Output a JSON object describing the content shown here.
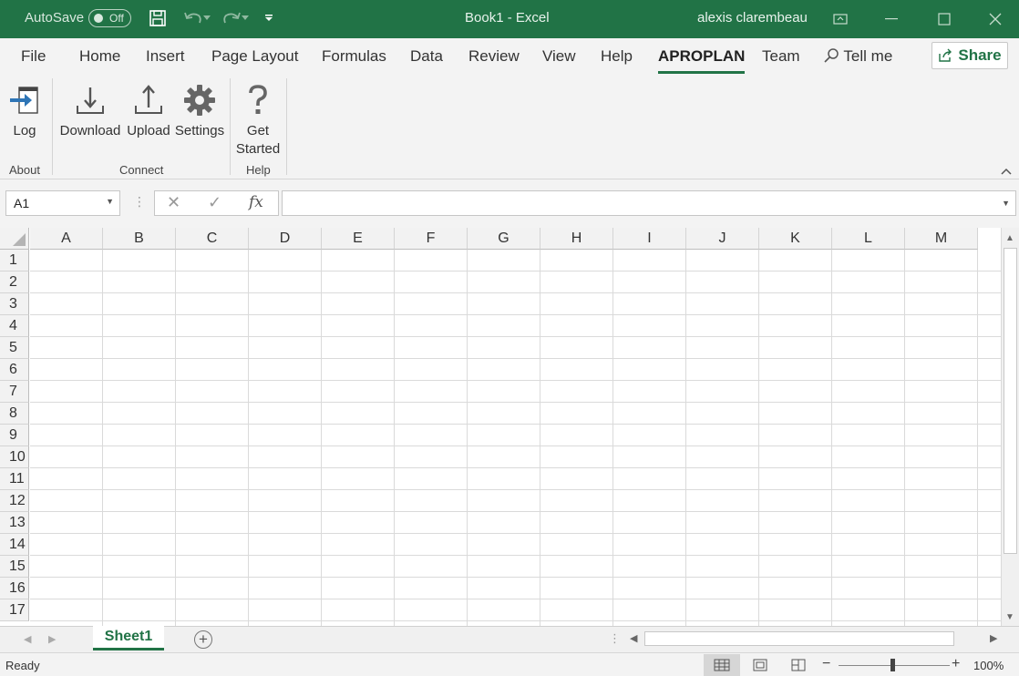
{
  "titlebar": {
    "autosave_label": "AutoSave",
    "autosave_state": "Off",
    "title": "Book1  -  Excel",
    "user": "alexis clarembeau"
  },
  "tabs": [
    {
      "label": "File"
    },
    {
      "label": "Home"
    },
    {
      "label": "Insert"
    },
    {
      "label": "Page Layout"
    },
    {
      "label": "Formulas"
    },
    {
      "label": "Data"
    },
    {
      "label": "Review"
    },
    {
      "label": "View"
    },
    {
      "label": "Help"
    },
    {
      "label": "APROPLAN",
      "active": true
    },
    {
      "label": "Team"
    }
  ],
  "tell_me": "Tell me",
  "share_label": "Share",
  "ribbon": {
    "buttons": [
      {
        "label": "Log",
        "icon": "log-icon"
      },
      {
        "label": "Download",
        "icon": "download-icon"
      },
      {
        "label": "Upload",
        "icon": "upload-icon"
      },
      {
        "label": "Settings",
        "icon": "gear-icon"
      },
      {
        "label": "Get Started",
        "icon": "question-icon"
      }
    ],
    "groups": [
      "About",
      "Connect",
      "Help"
    ]
  },
  "formula_bar": {
    "name_box": "A1",
    "formula": ""
  },
  "grid": {
    "columns": [
      "A",
      "B",
      "C",
      "D",
      "E",
      "F",
      "G",
      "H",
      "I",
      "J",
      "K",
      "L",
      "M"
    ],
    "rows": [
      "1",
      "2",
      "3",
      "4",
      "5",
      "6",
      "7",
      "8",
      "9",
      "10",
      "11",
      "12",
      "13",
      "14",
      "15",
      "16",
      "17"
    ]
  },
  "sheets": [
    {
      "name": "Sheet1",
      "active": true
    }
  ],
  "status": {
    "text": "Ready",
    "zoom": "100%"
  },
  "colors": {
    "accent": "#217346"
  }
}
